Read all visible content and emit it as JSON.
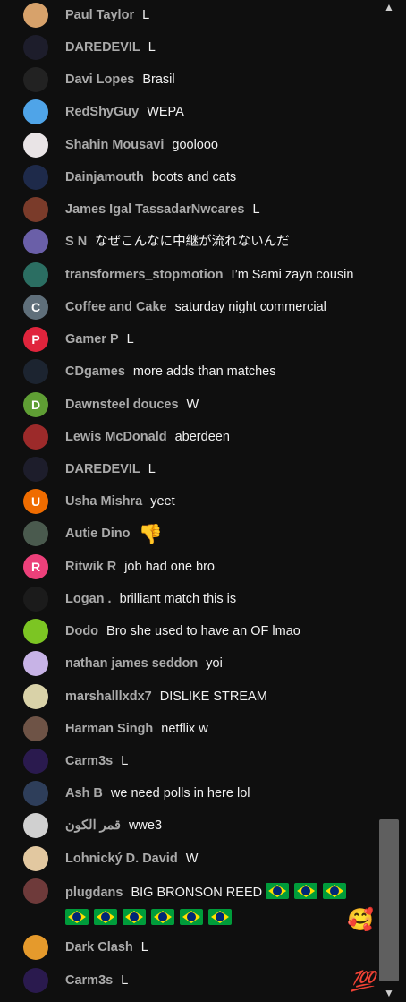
{
  "chat": {
    "messages": [
      {
        "author": "Paul Taylor",
        "text": "L",
        "avatar_color": "#d7a26b",
        "avatar_letter": "",
        "avatar_icon": "face-avatar"
      },
      {
        "author": "DAREDEVIL",
        "text": "L",
        "avatar_color": "#1d1d2b",
        "avatar_letter": "",
        "avatar_icon": "mask-avatar"
      },
      {
        "author": "Davi Lopes",
        "text": "Brasil",
        "avatar_color": "#222222",
        "avatar_letter": "",
        "avatar_icon": "logo-avatar"
      },
      {
        "author": "RedShyGuy",
        "text": "WEPA",
        "avatar_color": "#4fa4e8",
        "avatar_letter": "",
        "avatar_icon": "shyguy-avatar"
      },
      {
        "author": "Shahin Mousavi",
        "text": "goolooo",
        "avatar_color": "#e9e4e6",
        "avatar_letter": "",
        "avatar_icon": "photo-avatar"
      },
      {
        "author": "Dainjamouth",
        "text": "boots and cats",
        "avatar_color": "#1e2a4a",
        "avatar_letter": "",
        "avatar_icon": "anime-avatar"
      },
      {
        "author": "James Igal TassadarNwcares",
        "text": "L",
        "avatar_color": "#7a3b2a",
        "avatar_letter": "",
        "avatar_icon": "art-avatar"
      },
      {
        "author": "S N",
        "text": "なぜこんなに中継が流れないんだ",
        "avatar_color": "#6a5fa8",
        "avatar_letter": "",
        "avatar_icon": "collage-avatar"
      },
      {
        "author": "transformers_stopmotion",
        "text": "I’m Sami zayn cousin",
        "avatar_color": "#2b6e62",
        "avatar_letter": "",
        "avatar_icon": "llama-avatar"
      },
      {
        "author": "Coffee and Cake",
        "text": "saturday night commercial",
        "avatar_color": "#5f6f7a",
        "avatar_letter": "C",
        "avatar_icon": "letter-avatar"
      },
      {
        "author": "Gamer P",
        "text": "L",
        "avatar_color": "#e0243c",
        "avatar_letter": "P",
        "avatar_icon": "letter-avatar"
      },
      {
        "author": "CDgames",
        "text": "more adds than matches",
        "avatar_color": "#1c2430",
        "avatar_letter": "",
        "avatar_icon": "logo-avatar"
      },
      {
        "author": "Dawnsteel douces",
        "text": "W",
        "avatar_color": "#5f9e34",
        "avatar_letter": "D",
        "avatar_icon": "letter-avatar"
      },
      {
        "author": "Lewis McDonald",
        "text": "aberdeen",
        "avatar_color": "#9c2a2a",
        "avatar_letter": "",
        "avatar_icon": "team-avatar"
      },
      {
        "author": "DAREDEVIL",
        "text": "L",
        "avatar_color": "#1d1d2b",
        "avatar_letter": "",
        "avatar_icon": "mask-avatar"
      },
      {
        "author": "Usha Mishra",
        "text": "yeet",
        "avatar_color": "#ef6c00",
        "avatar_letter": "U",
        "avatar_icon": "letter-avatar"
      },
      {
        "author": "Autie Dino",
        "text": "👎",
        "avatar_color": "#4a5a4e",
        "avatar_letter": "",
        "avatar_icon": "landscape-avatar"
      },
      {
        "author": "Ritwik R",
        "text": "job had one bro",
        "avatar_color": "#ec407a",
        "avatar_letter": "R",
        "avatar_icon": "letter-avatar"
      },
      {
        "author": "Logan .",
        "text": "brilliant match this is",
        "avatar_color": "#1b1b1b",
        "avatar_letter": "",
        "avatar_icon": "logo-avatar"
      },
      {
        "author": "Dodo",
        "text": "Bro she used to have an OF lmao",
        "avatar_color": "#7cc523",
        "avatar_letter": "",
        "avatar_icon": "plain-avatar"
      },
      {
        "author": "nathan james seddon",
        "text": "yoi",
        "avatar_color": "#c7b3e6",
        "avatar_letter": "",
        "avatar_icon": "art-avatar"
      },
      {
        "author": "marshalllxdx7",
        "text": "DISLIKE STREAM",
        "avatar_color": "#d9d2a8",
        "avatar_letter": "",
        "avatar_icon": "duck-avatar"
      },
      {
        "author": "Harman Singh",
        "text": "netflix w",
        "avatar_color": "#6e5346",
        "avatar_letter": "",
        "avatar_icon": "photo-avatar"
      },
      {
        "author": "Carm3s",
        "text": "L",
        "avatar_color": "#2a1a4e",
        "avatar_letter": "",
        "avatar_icon": "logo-avatar"
      },
      {
        "author": "Ash B",
        "text": "we need polls in here lol",
        "avatar_color": "#2e3e5a",
        "avatar_letter": "",
        "avatar_icon": "photo-avatar"
      },
      {
        "author": "قمر الكون",
        "text": "wwe3",
        "avatar_color": "#d0d0d0",
        "avatar_letter": "",
        "avatar_icon": "sketch-avatar"
      },
      {
        "author": "Lohnický D. David",
        "text": "W",
        "avatar_color": "#e2c8a0",
        "avatar_letter": "",
        "avatar_icon": "anime-avatar"
      },
      {
        "author": "plugdans",
        "text": "BIG BRONSON REED",
        "avatar_color": "#6e3a3a",
        "avatar_letter": "",
        "avatar_icon": "photo-avatar",
        "flags_line1": 3,
        "flags_line2": 6
      },
      {
        "author": "Dark Clash",
        "text": "L",
        "avatar_color": "#e59a2c",
        "avatar_letter": "",
        "avatar_icon": "game-avatar"
      },
      {
        "author": "Carm3s",
        "text": "L",
        "avatar_color": "#2a1a4e",
        "avatar_letter": "",
        "avatar_icon": "logo-avatar"
      }
    ],
    "reactions": {
      "heart_face": "🥰",
      "hundred": "💯"
    }
  },
  "colors": {
    "background": "#0f0f0f",
    "author": "#aaaaaa",
    "text": "#f1f1f1",
    "scroll_thumb": "#5f5f5f"
  },
  "icons": {
    "scroll_up": "chevron-up-icon",
    "scroll_down": "chevron-down-icon"
  }
}
